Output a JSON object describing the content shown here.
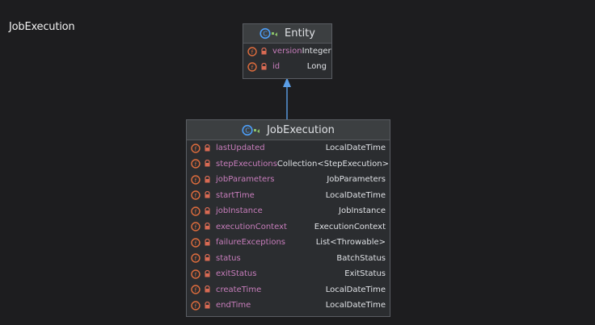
{
  "page": {
    "title": "JobExecution"
  },
  "diagram": {
    "classes": [
      {
        "name": "Entity",
        "fields": [
          {
            "name": "version",
            "type": "Integer"
          },
          {
            "name": "id",
            "type": "Long"
          }
        ]
      },
      {
        "name": "JobExecution",
        "fields": [
          {
            "name": "lastUpdated",
            "type": "LocalDateTime"
          },
          {
            "name": "stepExecutions",
            "type": "Collection<StepExecution>"
          },
          {
            "name": "jobParameters",
            "type": "JobParameters"
          },
          {
            "name": "startTime",
            "type": "LocalDateTime"
          },
          {
            "name": "jobInstance",
            "type": "JobInstance"
          },
          {
            "name": "executionContext",
            "type": "ExecutionContext"
          },
          {
            "name": "failureExceptions",
            "type": "List<Throwable>"
          },
          {
            "name": "status",
            "type": "BatchStatus"
          },
          {
            "name": "exitStatus",
            "type": "ExitStatus"
          },
          {
            "name": "createTime",
            "type": "LocalDateTime"
          },
          {
            "name": "endTime",
            "type": "LocalDateTime"
          }
        ]
      }
    ],
    "relationship": {
      "type": "inheritance"
    }
  },
  "icons": {
    "class": "class-icon",
    "field": "field-icon",
    "lock": "lock-icon"
  },
  "colors": {
    "background": "#1d1d1f",
    "header": "#3c3f41",
    "body": "#2b2d30",
    "border": "#5a5d63",
    "text": "#dfe1e5",
    "field_name": "#c77dbb",
    "field_icon": "#e06d3d",
    "lock_icon": "#d86a53",
    "class_icon": "#4d9ef7",
    "arrow": "#5b9ee6"
  }
}
